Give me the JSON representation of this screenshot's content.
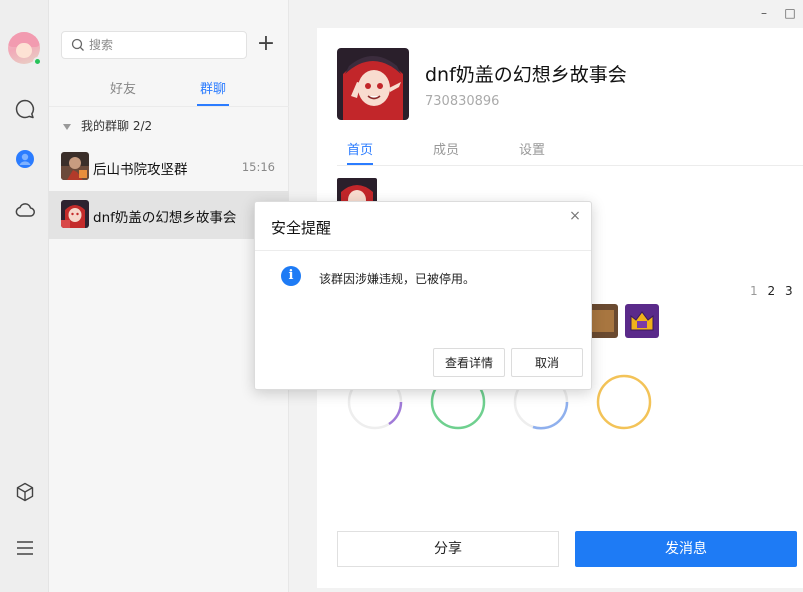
{
  "window": {
    "minimize_glyph": "–",
    "maximize_glyph": "□"
  },
  "sidebar": {
    "icons": [
      "avatar",
      "chat-icon",
      "contacts-icon",
      "cloud-icon",
      "cube-icon",
      "menu-icon"
    ]
  },
  "contacts": {
    "search": {
      "placeholder": "搜索",
      "value": ""
    },
    "add_glyph": "+",
    "tabs": [
      {
        "label": "好友",
        "active": false
      },
      {
        "label": "群聊",
        "active": true
      }
    ],
    "group_header": {
      "label": "我的群聊",
      "count": "2/2"
    },
    "items": [
      {
        "name": "后山书院攻坚群",
        "time": "15:16",
        "active": false
      },
      {
        "name": "dnf奶盖の幻想乡故事会",
        "time": "",
        "active": true
      }
    ]
  },
  "group_profile": {
    "name": "dnf奶盖の幻想乡故事会",
    "id": "730830896",
    "tabs": [
      {
        "label": "首页",
        "active": true
      },
      {
        "label": "成员",
        "active": false
      },
      {
        "label": "设置",
        "active": false
      }
    ],
    "pager": [
      "1",
      "2",
      "3"
    ],
    "share_label": "分享",
    "send_label": "发消息"
  },
  "colors": {
    "accent": "#1e7bf5",
    "online": "#27c35a"
  },
  "dialog": {
    "title": "安全提醒",
    "close_glyph": "×",
    "info_glyph": "i",
    "message": "该群因涉嫌违规，已被停用。",
    "details_label": "查看详情",
    "cancel_label": "取消"
  }
}
